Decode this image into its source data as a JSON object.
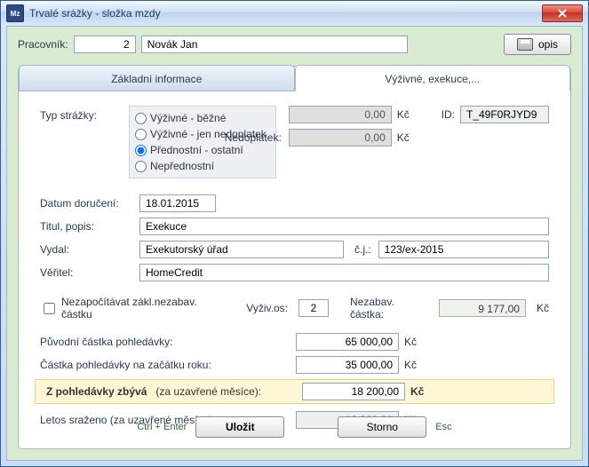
{
  "window": {
    "title": "Trvalé srážky - složka mzdy"
  },
  "header": {
    "employee_label": "Pracovník:",
    "employee_no": "2",
    "employee_name": "Novák Jan",
    "print_button": "opis"
  },
  "tabs": {
    "basic": "Základní informace",
    "alimony": "Výživné, exekuce,..."
  },
  "type_group": {
    "label": "Typ strážky:",
    "options": {
      "vyzivne_bezne": "Výživné - běžné",
      "vyzivne_nedoplatek": "Výživné - jen nedoplatek",
      "prednostni": "Přednostní - ostatní",
      "neprednostni": "Nepřednostní"
    },
    "selected": "prednostni"
  },
  "top_amounts": {
    "amount": "0,00",
    "unit": "Kč",
    "arrears_label": "Nedoplatek:",
    "arrears": "0,00",
    "id_label": "ID:",
    "id_value": "T_49F0RJYD9"
  },
  "details": {
    "date_label": "Datum doručení:",
    "date": "18.01.2015",
    "title_label": "Titul, popis:",
    "title": "Exekuce",
    "issued_label": "Vydal:",
    "issued": "Exekutorský úřad",
    "cj_label": "č.j.:",
    "cj": "123/ex-2015",
    "creditor_label": "Věřitel:",
    "creditor": "HomeCredit"
  },
  "options": {
    "skip_min_label": "Nezapočítávat zákl.nezabav. částku",
    "dependents_label": "Vyživ.os:",
    "dependents": "2",
    "unseizable_label": "Nezabav. částka:",
    "unseizable": "9 177,00",
    "unit": "Kč"
  },
  "amounts": {
    "original_label": "Původní částka pohledávky:",
    "original": "65 000,00",
    "year_start_label": "Částka pohledávky na začátku roku:",
    "year_start": "35 000,00",
    "remaining_label": "Z pohledávky zbývá",
    "remaining_note": "(za uzavřené měsíce):",
    "remaining": "18 200,00",
    "deducted_label": "Letos sraženo (za uzavřené měsíce):",
    "deducted": "16 800,00",
    "unit": "Kč"
  },
  "footer": {
    "save_hint": "Ctrl + Enter",
    "save": "Uložit",
    "cancel": "Storno",
    "cancel_hint": "Esc"
  }
}
